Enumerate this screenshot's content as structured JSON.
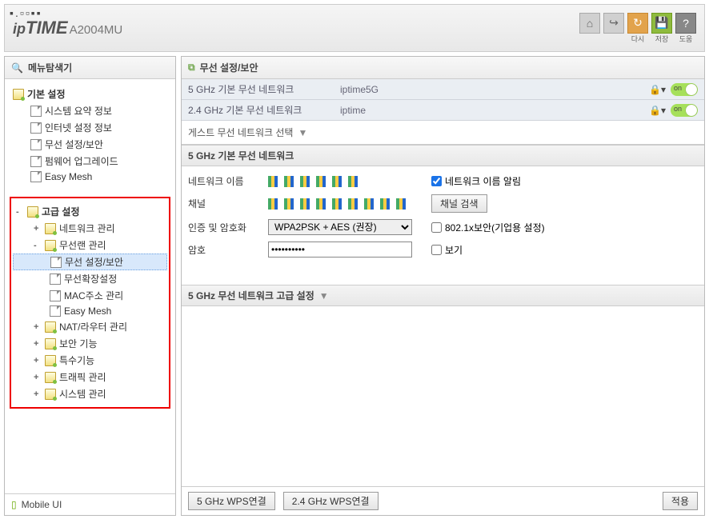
{
  "header": {
    "brand_ip": "ip",
    "brand_time": "TIME",
    "model": "A2004MU",
    "btns": {
      "reload": "다시",
      "save": "저장",
      "help": "도움"
    }
  },
  "sidebar": {
    "title": "메뉴탐색기",
    "basic": {
      "label": "기본 설정",
      "items": [
        "시스템 요약 정보",
        "인터넷 설정 정보",
        "무선 설정/보안",
        "펌웨어 업그레이드",
        "Easy Mesh"
      ]
    },
    "adv": {
      "label": "고급 설정",
      "items": [
        {
          "label": "네트워크 관리",
          "expand": "+"
        },
        {
          "label": "무선랜 관리",
          "expand": "-",
          "children": [
            "무선 설정/보안",
            "무선확장설정",
            "MAC주소 관리",
            "Easy Mesh"
          ]
        },
        {
          "label": "NAT/라우터 관리",
          "expand": "+"
        },
        {
          "label": "보안 기능",
          "expand": "+"
        },
        {
          "label": "특수기능",
          "expand": "+"
        },
        {
          "label": "트래픽 관리",
          "expand": "+"
        },
        {
          "label": "시스템 관리",
          "expand": "+"
        }
      ]
    },
    "footer": "Mobile UI"
  },
  "content": {
    "title": "무선 설정/보안",
    "networks": [
      {
        "label": "5 GHz 기본 무선 네트워크",
        "ssid": "iptime5G",
        "on": true
      },
      {
        "label": "2.4 GHz 기본 무선 네트워크",
        "ssid": "iptime",
        "on": true
      }
    ],
    "guest_label": "게스트 무선 네트워크 선택",
    "section_5g": "5 GHz 기본 무선 네트워크",
    "form": {
      "netname_label": "네트워크 이름",
      "broadcast_label": "네트워크 이름 알림",
      "channel_label": "채널",
      "channel_btn": "채널 검색",
      "auth_label": "인증 및 암호화",
      "auth_value": "WPA2PSK + AES (권장)",
      "dot1x_label": "802.1x보안(기업용 설정)",
      "pw_label": "암호",
      "pw_value": "••••••••••",
      "show_label": "보기"
    },
    "adv_section": "5 GHz 무선 네트워크 고급 설정",
    "footer": {
      "wps5": "5 GHz WPS연결",
      "wps24": "2.4 GHz WPS연결",
      "apply": "적용"
    }
  }
}
